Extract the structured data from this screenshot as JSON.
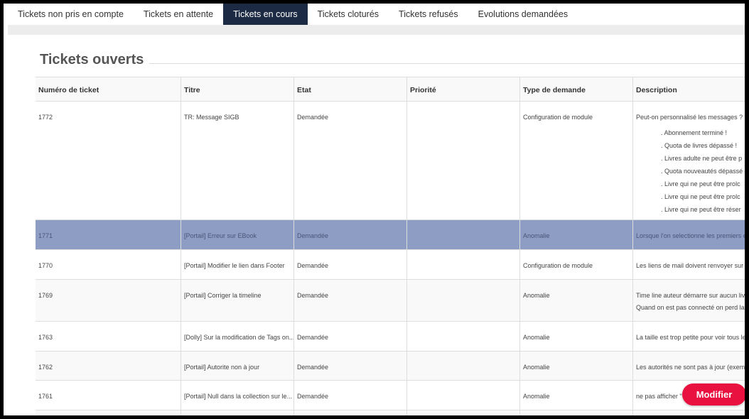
{
  "tabs": [
    {
      "label": "Tickets non pris en compte",
      "active": false
    },
    {
      "label": "Tickets en attente",
      "active": false
    },
    {
      "label": "Tickets en cours",
      "active": true
    },
    {
      "label": "Tickets cloturés",
      "active": false
    },
    {
      "label": "Tickets refusés",
      "active": false
    },
    {
      "label": "Evolutions demandées",
      "active": false
    }
  ],
  "section": {
    "title": "Tickets ouverts"
  },
  "table": {
    "headers": [
      "Numéro de ticket",
      "Titre",
      "Etat",
      "Priorité",
      "Type de demande",
      "Description"
    ],
    "rows": [
      {
        "id": "1772",
        "title": "TR: Message SIGB",
        "state": "Demandée",
        "priority": "",
        "type": "Configuration de module",
        "description": [
          "Peut-on personnalisé les messages ?",
          ". Abonnement terminé !",
          ". Quota de livres dépassé !",
          ". Livres adulte ne peut être p",
          ". Quota nouveautés dépassé",
          ". Livre qui ne peut être prolc",
          ". Livre qui ne peut être prolc",
          ". Livre qui ne peut être réser"
        ]
      },
      {
        "id": "1771",
        "title": "[Portail] Erreur sur EBook",
        "state": "Demandée",
        "priority": "",
        "type": "Anomalie",
        "description": [
          "Lorsque l'on selectionne les premiers e"
        ]
      },
      {
        "id": "1770",
        "title": "[Portail] Modifier le lien dans Footer",
        "state": "Demandée",
        "priority": "",
        "type": "Configuration de module",
        "description": [
          "Les liens de mail doivent renvoyer sur"
        ]
      },
      {
        "id": "1769",
        "title": "[Portail] Corriger la timeline",
        "state": "Demandée",
        "priority": "",
        "type": "Anomalie",
        "description": [
          "Time line auteur démarre sur aucun liv",
          "Quand on est pas connecté on perd la"
        ]
      },
      {
        "id": "1763",
        "title": "[Dolly] Sur la modification de Tags on...",
        "state": "Demandée",
        "priority": "",
        "type": "Anomalie",
        "description": [
          "La taille est trop petite pour voir tous le"
        ]
      },
      {
        "id": "1762",
        "title": "[Portail] Autorite non à jour",
        "state": "Demandée",
        "priority": "",
        "type": "Anomalie",
        "description": [
          "Les autorités ne sont pas à jour (exemp"
        ]
      },
      {
        "id": "1761",
        "title": "[Portail] Null dans la collection sur le...",
        "state": "Demandée",
        "priority": "",
        "type": "Anomalie",
        "description": [
          "ne pas afficher \" n"
        ]
      }
    ]
  },
  "buttons": {
    "modify_label": "Modifier"
  },
  "colors": {
    "active_tab": "#1c2a44",
    "selected_row": "#8d9dc4",
    "modify_button": "#e8113f"
  }
}
